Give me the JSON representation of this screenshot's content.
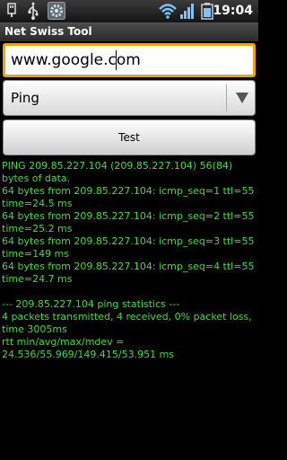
{
  "status_bar": {
    "time": "19:04",
    "icons": [
      "usb-icon",
      "usb-debug-icon",
      "settings-icon",
      "wifi-icon",
      "signal-icon",
      "battery-icon"
    ]
  },
  "app": {
    "title": "Net Swiss Tool"
  },
  "host_input": {
    "value": "www.google.com",
    "placeholder": ""
  },
  "tool_select": {
    "selected": "Ping"
  },
  "test_button": {
    "label": "Test"
  },
  "output_lines": [
    "PING 209.85.227.104 (209.85.227.104) 56(84) bytes of data.",
    "64 bytes from 209.85.227.104: icmp_seq=1 ttl=55 time=24.5 ms",
    "64 bytes from 209.85.227.104: icmp_seq=2 ttl=55 time=25.2 ms",
    "64 bytes from 209.85.227.104: icmp_seq=3 ttl=55 time=149 ms",
    "64 bytes from 209.85.227.104: icmp_seq=4 ttl=55 time=24.7 ms",
    "--- 209.85.227.104 ping statistics ---",
    "4 packets transmitted, 4 received, 0% packet loss, time 3005ms",
    "rtt min/avg/max/mdev = 24.536/55.969/149.415/53.951 ms"
  ],
  "colors": {
    "output_text": "#3ddc3d",
    "focus_border": "#f5a100",
    "background": "#000000"
  }
}
